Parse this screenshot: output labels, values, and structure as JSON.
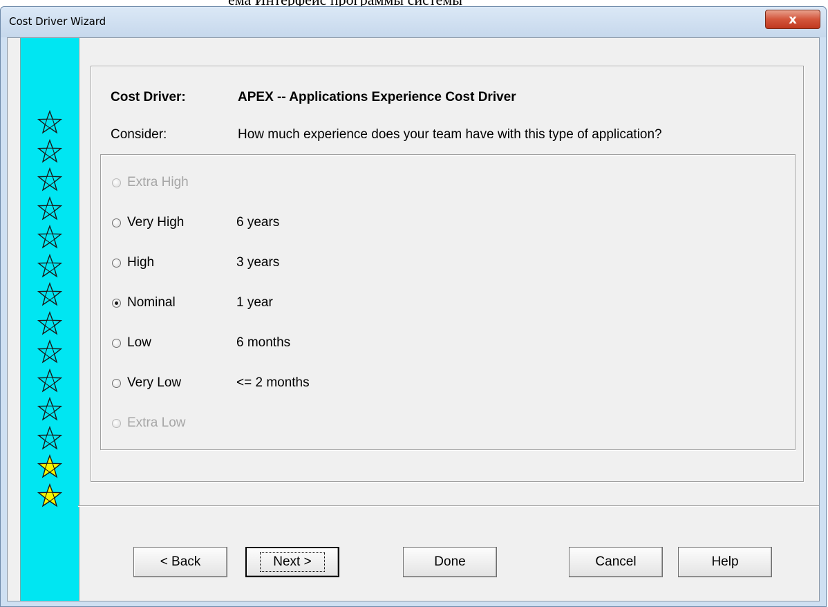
{
  "window": {
    "title": "Cost Driver Wizard",
    "close_label": "x"
  },
  "header": {
    "cost_driver_label": "Cost Driver:",
    "cost_driver_value": "APEX -- Applications Experience Cost Driver",
    "consider_label": "Consider:",
    "consider_value": "How much experience does your team have with this type of application?"
  },
  "ratings": [
    {
      "label": "Extra High",
      "desc": "",
      "enabled": false,
      "checked": false
    },
    {
      "label": "Very High",
      "desc": "6 years",
      "enabled": true,
      "checked": false
    },
    {
      "label": "High",
      "desc": "3 years",
      "enabled": true,
      "checked": false
    },
    {
      "label": "Nominal",
      "desc": "1 year",
      "enabled": true,
      "checked": true
    },
    {
      "label": "Low",
      "desc": "6 months",
      "enabled": true,
      "checked": false
    },
    {
      "label": "Very Low",
      "desc": "<= 2 months",
      "enabled": true,
      "checked": false
    },
    {
      "label": "Extra Low",
      "desc": "",
      "enabled": false,
      "checked": false
    }
  ],
  "buttons": {
    "back": "< Back",
    "next": "Next >",
    "done": "Done",
    "cancel": "Cancel",
    "help": "Help"
  },
  "sidebar": {
    "star_count": 14,
    "highlighted_count": 2,
    "star_color": "#00e6f2",
    "highlight_color": "#f5f500"
  }
}
